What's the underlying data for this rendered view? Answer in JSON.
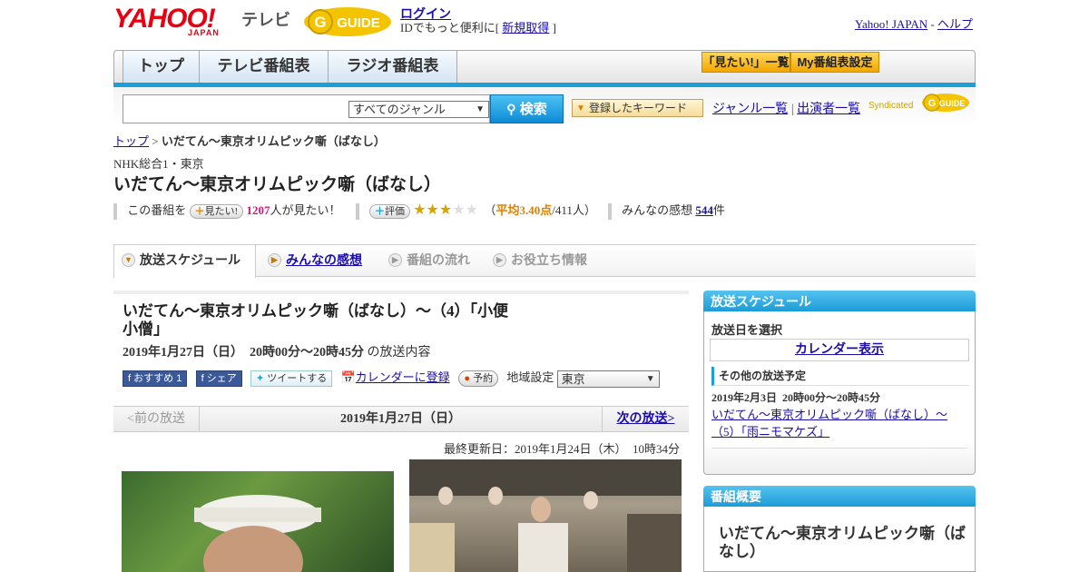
{
  "header": {
    "logo_text": "YAHOO!",
    "logo_sub": "JAPAN",
    "service_label": "テレビ",
    "gguide_text": "GUIDE",
    "login_label": "ログイン",
    "login_sub_prefix": "IDでもっと便利に[",
    "register_label": "新規取得",
    "login_sub_suffix": "]",
    "yahoo_japan_link": "Yahoo! JAPAN",
    "separator": " - ",
    "help_link": "ヘルプ"
  },
  "nav": {
    "tabs": [
      "トップ",
      "テレビ番組表",
      "ラジオ番組表"
    ],
    "mitai_list": "「見たい!」一覧",
    "my_schedule": "My番組表設定"
  },
  "search": {
    "genre_selected": "すべてのジャンル",
    "button_label": "検索",
    "keyword_button": "登録したキーワード",
    "genre_list_link": "ジャンル一覧",
    "divider": "|",
    "performer_link": "出演者一覧",
    "syndicated_label": "Syndicated"
  },
  "breadcrumb": {
    "top": "トップ",
    "sep": " > ",
    "current": "いだてん～東京オリムピック噺（ばなし）"
  },
  "program": {
    "channel": "NHK総合1・東京",
    "title": "いだてん～東京オリムピック噺（ばなし）",
    "mitai_prefix": "この番組を",
    "mitai_button": "見たい!",
    "mitai_count": "1207",
    "mitai_suffix": "人が見たい！",
    "rate_button": "評価",
    "rating_value": 3.4,
    "rating_stars_max": 5,
    "rating_open": "（",
    "rating_avg": "平均3.40点",
    "rating_count": "/411人）",
    "impressions_label": "みんなの感想",
    "impressions_count": "544",
    "impressions_unit": "件"
  },
  "tabs": [
    {
      "label": "放送スケジュール",
      "state": "active"
    },
    {
      "label": "みんなの感想",
      "state": "link"
    },
    {
      "label": "番組の流れ",
      "state": "disabled"
    },
    {
      "label": "お役立ち情報",
      "state": "disabled"
    }
  ],
  "episode": {
    "title": "いだてん～東京オリムピック噺（ばなし）～（4）「小便小僧」",
    "time": "2019年1月27日（日）  20時00分～20時45分",
    "time_suffix": "の放送内容",
    "recommend_label": "おすすめ",
    "recommend_count": "1",
    "share_label": "シェア",
    "tweet_label": "ツイートする",
    "calendar_link": "カレンダーに登録",
    "reserve_label": "予約",
    "region_label": "地域設定",
    "region_value": "東京"
  },
  "pager": {
    "prev": "<前の放送",
    "current": "2019年1月27日（日）",
    "next": "次の放送>"
  },
  "updated": "最終更新日：2019年1月24日（木）  10時34分",
  "sidebar": {
    "schedule_head": "放送スケジュール",
    "select_date": "放送日を選択",
    "calendar_button": "カレンダー表示",
    "other_head": "その他の放送予定",
    "other_time": "2019年2月3日  20時00分～20時45分",
    "other_link": "いだてん～東京オリムピック噺（ばなし）～（5）「雨ニモマケズ」",
    "summary_head": "番組概要",
    "summary_title": "いだてん～東京オリムピック噺（ばなし）"
  },
  "colors": {
    "accent_blue": "#1a9fd9",
    "link": "#1a0dab",
    "yahoo_red": "#e60012",
    "pink": "#d6177a"
  }
}
